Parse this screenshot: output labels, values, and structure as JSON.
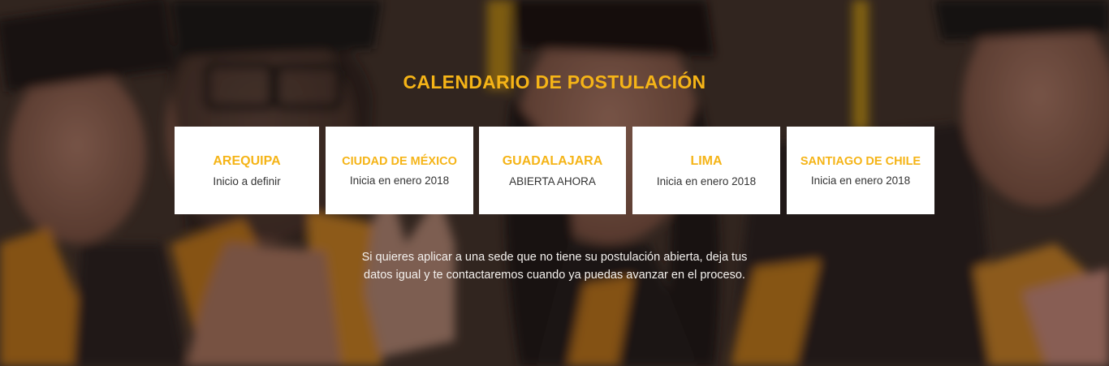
{
  "section": {
    "title": "CALENDARIO DE POSTULACIÓN",
    "note_line1": "Si quieres aplicar a una sede que no tiene su postulación abierta, deja tus",
    "note_line2": "datos igual y te contactaremos cuando  ya puedas avanzar en el proceso."
  },
  "cards": [
    {
      "city": "AREQUIPA",
      "status": "Inicio a definir"
    },
    {
      "city": "CIUDAD DE MÉXICO",
      "status": "Inicia en enero 2018"
    },
    {
      "city": "GUADALAJARA",
      "status": "ABIERTA AHORA"
    },
    {
      "city": "LIMA",
      "status": "Inicia en enero 2018"
    },
    {
      "city": "SANTIAGO DE CHILE",
      "status": "Inicia en enero 2018"
    }
  ],
  "colors": {
    "accent": "#f5b417",
    "card_bg": "#ffffff",
    "card_text": "#333333"
  }
}
